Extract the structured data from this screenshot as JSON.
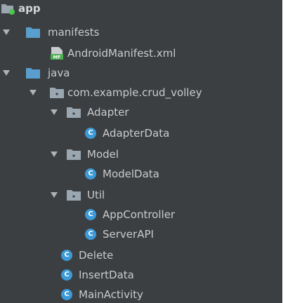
{
  "project_tree": {
    "items": [
      {
        "label": "app",
        "icon": "module-folder-icon",
        "depth": 0,
        "expandable": false,
        "bold": true
      },
      {
        "label": "manifests",
        "icon": "folder-icon",
        "depth": 0,
        "expandable": true,
        "expanded": true
      },
      {
        "label": "AndroidManifest.xml",
        "icon": "manifest-file-icon",
        "depth": 1,
        "expandable": false
      },
      {
        "label": "java",
        "icon": "folder-icon",
        "depth": 0,
        "expandable": true,
        "expanded": true
      },
      {
        "label": "com.example.crud_volley",
        "icon": "package-icon",
        "depth": 1,
        "expandable": true,
        "expanded": true
      },
      {
        "label": "Adapter",
        "icon": "package-icon",
        "depth": 2,
        "expandable": true,
        "expanded": true
      },
      {
        "label": "AdapterData",
        "icon": "java-class-icon",
        "depth": 3,
        "expandable": false
      },
      {
        "label": "Model",
        "icon": "package-icon",
        "depth": 2,
        "expandable": true,
        "expanded": true
      },
      {
        "label": "ModelData",
        "icon": "java-class-icon",
        "depth": 3,
        "expandable": false
      },
      {
        "label": "Util",
        "icon": "package-icon",
        "depth": 2,
        "expandable": true,
        "expanded": true
      },
      {
        "label": "AppController",
        "icon": "java-class-icon",
        "depth": 3,
        "expandable": false
      },
      {
        "label": "ServerAPI",
        "icon": "java-class-icon",
        "depth": 3,
        "expandable": false
      },
      {
        "label": "Delete",
        "icon": "java-class-icon",
        "depth": 2,
        "expandable": false
      },
      {
        "label": "InsertData",
        "icon": "java-class-icon",
        "depth": 2,
        "expandable": false
      },
      {
        "label": "MainActivity",
        "icon": "java-class-icon",
        "depth": 2,
        "expandable": false
      }
    ]
  },
  "colors": {
    "background": "#3c3f41",
    "text": "#c9cbce",
    "folder": "#5a9ecf",
    "class_icon": "#3d9ad8",
    "module_badge": "#4cc552"
  },
  "icons": {
    "class_letter": "C",
    "manifest_badge": "MF"
  }
}
